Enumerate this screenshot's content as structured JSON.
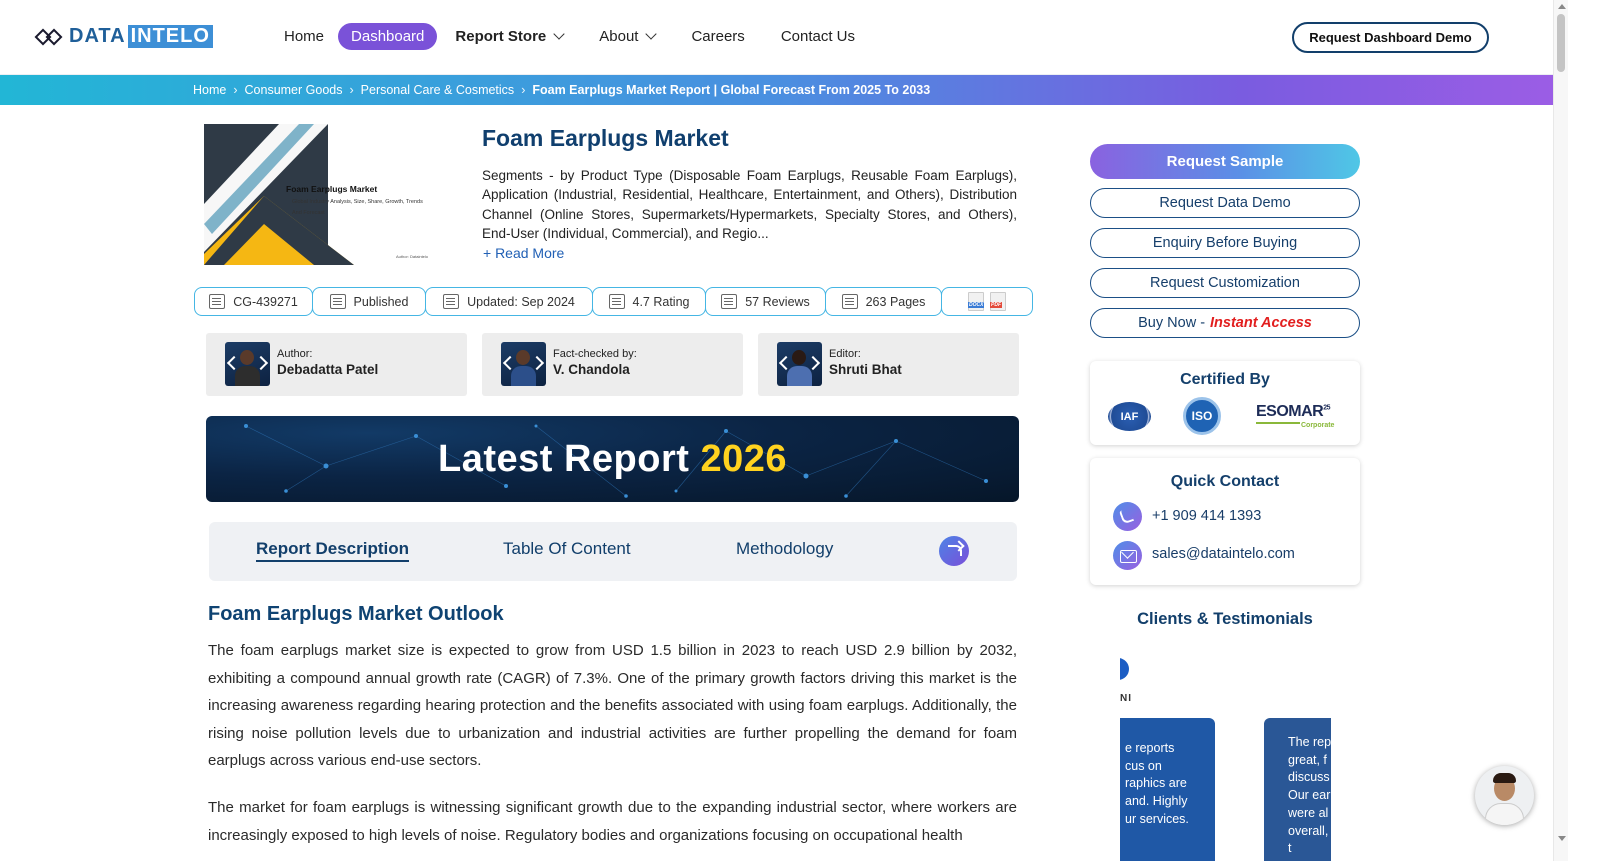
{
  "header": {
    "logo": {
      "part1": "DATA",
      "part2": "INTELO"
    },
    "nav": [
      {
        "label": "Home"
      },
      {
        "label": "Dashboard"
      },
      {
        "label": "Report Store"
      },
      {
        "label": "About"
      },
      {
        "label": "Careers"
      },
      {
        "label": "Contact Us"
      }
    ],
    "demo_button": "Request Dashboard Demo"
  },
  "breadcrumb": {
    "items": [
      "Home",
      "Consumer Goods",
      "Personal Care & Cosmetics"
    ],
    "current": "Foam Earplugs Market Report | Global Forecast From 2025 To 2033"
  },
  "cover": {
    "title": "Foam Earplugs Market",
    "subtitle": "Global Industry Analysis, Size, Share, Growth, Trends And Forecast",
    "author": "Author: Dataintelo"
  },
  "report": {
    "title": "Foam Earplugs Market",
    "segments": "Segments - by Product Type (Disposable Foam Earplugs, Reusable Foam Earplugs), Application (Industrial, Residential, Healthcare, Entertainment, and Others), Distribution Channel (Online Stores, Supermarkets/Hypermarkets, Specialty Stores, and Others), End-User (Individual, Commercial), and Regio...",
    "read_more": "+ Read More",
    "meta": {
      "id": "CG-439271",
      "status": "Published",
      "updated": "Updated: Sep 2024",
      "rating": "4.7 Rating",
      "reviews": "57 Reviews",
      "pages": "263 Pages",
      "format_doc": "DOCX",
      "format_pdf": "PDF"
    }
  },
  "people": [
    {
      "role": "Author:",
      "name": "Debadatta Patel"
    },
    {
      "role": "Fact-checked by:",
      "name": "V. Chandola"
    },
    {
      "role": "Editor:",
      "name": "Shruti Bhat"
    }
  ],
  "banner": {
    "text": "Latest Report",
    "year": "2026"
  },
  "tabs": [
    {
      "label": "Report Description"
    },
    {
      "label": "Table Of Content"
    },
    {
      "label": "Methodology"
    }
  ],
  "article": {
    "heading": "Foam Earplugs Market Outlook",
    "para1": "The foam earplugs market size is expected to grow from USD 1.5 billion in 2023 to reach USD 2.9 billion by 2032, exhibiting a compound annual growth rate (CAGR) of 7.3%. One of the primary growth factors driving this market is the increasing awareness regarding hearing protection and the benefits associated with using foam earplugs. Additionally, the rising noise pollution levels due to urbanization and industrial activities are further propelling the demand for foam earplugs across various end-use sectors.",
    "para2": "The market for foam earplugs is witnessing significant growth due to the expanding industrial sector, where workers are increasingly exposed to high levels of noise. Regulatory bodies and organizations focusing on occupational health"
  },
  "sidebar": {
    "request_sample": "Request Sample",
    "buttons": [
      "Request Data Demo",
      "Enquiry Before Buying",
      "Request Customization"
    ],
    "buy_now": "Buy Now -",
    "instant_access": "Instant Access",
    "certified_title": "Certified By",
    "certs": {
      "iaf": "IAF",
      "iso": "ISO",
      "esomar": "ESOMAR",
      "esomar_sup": "25",
      "esomar_sub": "Corporate"
    },
    "quick_contact_title": "Quick Contact",
    "phone": "+1 909 414 1393",
    "email": "sales@dataintelo.com",
    "clients_title": "Clients & Testimonials",
    "client_label_fragment": "NI",
    "testimonial_a": [
      "e reports",
      "cus on",
      "raphics are",
      "and. Highly",
      "ur services."
    ],
    "testimonial_b": [
      "The rep",
      "great, f",
      "discuss",
      "Our ear",
      "were al",
      "overall,",
      "t"
    ]
  },
  "colors": {
    "brand_blue": "#123f6b",
    "accent_purple": "#7a52d8",
    "banner_year": "#ffd21f",
    "instant_access": "#e21e1e"
  }
}
